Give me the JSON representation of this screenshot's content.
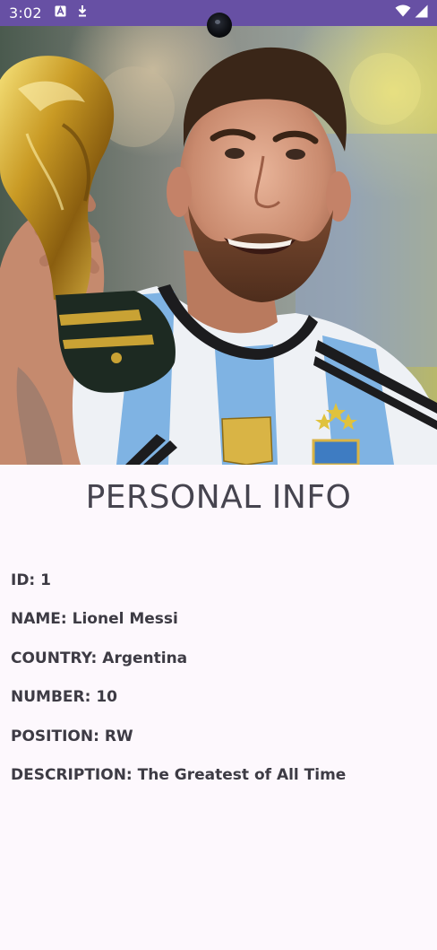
{
  "status_bar": {
    "time": "3:02",
    "left_icons": [
      "text-a-icon",
      "download-arrow-icon"
    ],
    "right_icons": [
      "wifi-icon",
      "signal-icon"
    ]
  },
  "hero_image": {
    "description_icon": "player-photo"
  },
  "page": {
    "title": "PERSONAL INFO"
  },
  "player": {
    "id_label": "ID:",
    "id_value": "1",
    "name_label": "NAME:",
    "name_value": "Lionel Messi",
    "country_label": "COUNTRY:",
    "country_value": "Argentina",
    "number_label": "NUMBER:",
    "number_value": "10",
    "position_label": "POSITION:",
    "position_value": "RW",
    "description_label": "DESCRIPTION:",
    "description_value": "The Greatest of All Time"
  },
  "colors": {
    "status_bar": "#6750a4",
    "background": "#fdf8fd",
    "title_text": "#46444f",
    "info_text": "#3d3b44"
  }
}
